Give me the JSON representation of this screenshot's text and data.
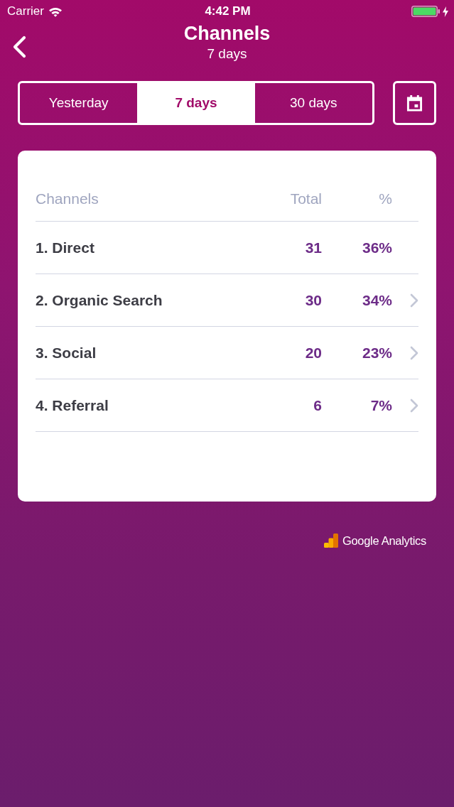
{
  "status_bar": {
    "carrier": "Carrier",
    "time": "4:42 PM",
    "charging": true
  },
  "nav": {
    "title": "Channels",
    "subtitle": "7 days"
  },
  "periods": [
    {
      "label": "Yesterday",
      "selected": false
    },
    {
      "label": "7 days",
      "selected": true
    },
    {
      "label": "30 days",
      "selected": false
    }
  ],
  "table": {
    "columns": [
      "Channels",
      "Total",
      "%"
    ],
    "rows": [
      {
        "channel": "1. Direct",
        "total": "31",
        "percent": "36%",
        "has_details": false
      },
      {
        "channel": "2. Organic Search",
        "total": "30",
        "percent": "34%",
        "has_details": true
      },
      {
        "channel": "3. Social",
        "total": "20",
        "percent": "23%",
        "has_details": true
      },
      {
        "channel": "4. Referral",
        "total": "6",
        "percent": "7%",
        "has_details": true
      }
    ]
  },
  "footer": {
    "brand": "Google Analytics"
  }
}
